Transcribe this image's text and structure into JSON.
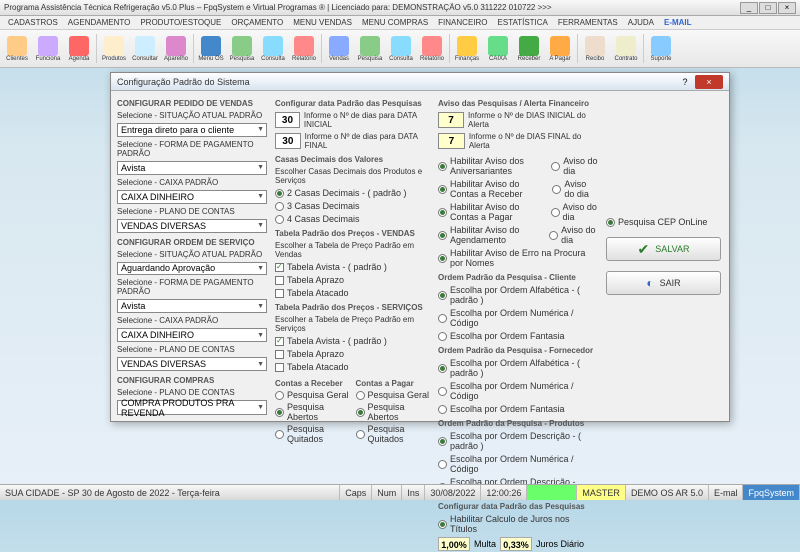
{
  "window": {
    "title": "Programa Assistência Técnica Refrigeração v5.0 Plus – FpqSystem e Virtual Programas ® | Licenciado para: DEMONSTRAÇÃO v5.0 311222 010722 >>>"
  },
  "menu": [
    "CADASTROS",
    "AGENDAMENTO",
    "PRODUTO/ESTOQUE",
    "ORÇAMENTO",
    "MENU VENDAS",
    "MENU COMPRAS",
    "FINANCEIRO",
    "ESTATÍSTICA",
    "FERRAMENTAS",
    "AJUDA",
    "E-MAIL"
  ],
  "toolbar": [
    {
      "label": "Clientes",
      "c": "#ffcc88"
    },
    {
      "label": "Funciona",
      "c": "#ccaaff"
    },
    {
      "label": "Agenda",
      "c": "#ff6666"
    },
    {
      "label": "Produtos",
      "c": "#ffeecc"
    },
    {
      "label": "Consultar",
      "c": "#cceeff"
    },
    {
      "label": "Aparelho",
      "c": "#dd88cc"
    },
    {
      "label": "Menu OS",
      "c": "#4488cc"
    },
    {
      "label": "Pesquisa",
      "c": "#88cc88"
    },
    {
      "label": "Consulta",
      "c": "#88ddff"
    },
    {
      "label": "Relatório",
      "c": "#ff8888"
    },
    {
      "label": "Vendas",
      "c": "#88aaff"
    },
    {
      "label": "Pesquisa",
      "c": "#88cc88"
    },
    {
      "label": "Consulta",
      "c": "#88ddff"
    },
    {
      "label": "Relatório",
      "c": "#ff8888"
    },
    {
      "label": "Finanças",
      "c": "#ffcc44"
    },
    {
      "label": "CAIXA",
      "c": "#66dd88"
    },
    {
      "label": "Receber",
      "c": "#44aa44"
    },
    {
      "label": "A Pagar",
      "c": "#ffaa44"
    },
    {
      "label": "Recibo",
      "c": "#eeddcc"
    },
    {
      "label": "Contrato",
      "c": "#eeeecc"
    },
    {
      "label": "Suporte",
      "c": "#88ccff"
    }
  ],
  "dialog": {
    "title": "Configuração Padrão do Sistema",
    "vendas": {
      "head": "CONFIGURAR PEDIDO DE VENDAS",
      "sit_lbl": "Selecione - SITUAÇÃO ATUAL PADRÃO",
      "sit_val": "Entrega direto para o cliente",
      "pag_lbl": "Selecione - FORMA DE PAGAMENTO PADRÃO",
      "pag_val": "Avista",
      "cx_lbl": "Selecione - CAIXA PADRÃO",
      "cx_val": "CAIXA DINHEIRO",
      "pc_lbl": "Selecione - PLANO DE CONTAS",
      "pc_val": "VENDAS DIVERSAS"
    },
    "os": {
      "head": "CONFIGURAR ORDEM DE SERVIÇO",
      "sit_lbl": "Selecione - SITUAÇÃO ATUAL PADRÃO",
      "sit_val": "Aguardando Aprovação",
      "pag_lbl": "Selecione - FORMA DE PAGAMENTO PADRÃO",
      "pag_val": "Avista",
      "cx_lbl": "Selecione - CAIXA PADRÃO",
      "cx_val": "CAIXA DINHEIRO",
      "pc_lbl": "Selecione - PLANO DE CONTAS",
      "pc_val": "VENDAS DIVERSAS"
    },
    "compras": {
      "head": "CONFIGURAR COMPRAS",
      "pc_lbl": "Selecione - PLANO DE CONTAS",
      "pc_val": "COMPRA PRODUTOS PRA REVENDA"
    },
    "datas": {
      "head": "Configurar data Padrão das Pesquisas",
      "ini_val": "30",
      "ini_lbl": "Informe o Nº de dias para DATA INICIAL",
      "fin_val": "30",
      "fin_lbl": "Informe o Nº de dias para DATA FINAL"
    },
    "decimais": {
      "head": "Casas Decimais dos Valores",
      "sub": "Escolher Casas Decimais dos Produtos e Serviços",
      "o1": "2 Casas Decimais - ( padrão )",
      "o2": "3 Casas Decimais",
      "o3": "4 Casas Decimais"
    },
    "prevendas": {
      "head": "Tabela Padrão dos Preços - VENDAS",
      "sub": "Escolher a Tabela de Preço Padrão em Vendas",
      "o1": "Tabela Avista - ( padrão )",
      "o2": "Tabela Aprazo",
      "o3": "Tabela Atacado"
    },
    "preserv": {
      "head": "Tabela Padrão dos Preços - SERVIÇOS",
      "sub": "Escolher a Tabela de Preço Padrão em Serviços",
      "o1": "Tabela Avista - ( padrão )",
      "o2": "Tabela Aprazo",
      "o3": "Tabela Atacado"
    },
    "receber": {
      "head": "Contas a Receber",
      "o1": "Pesquisa Geral",
      "o2": "Pesquisa Abertos",
      "o3": "Pesquisa Quitados"
    },
    "pagar": {
      "head": "Contas a Pagar",
      "o1": "Pesquisa Geral",
      "o2": "Pesquisa Abertos",
      "o3": "Pesquisa Quitados"
    },
    "avisos": {
      "head": "Aviso das Pesquisas / Alerta Financeiro",
      "ini_val": "7",
      "ini_lbl": "Informe o Nº de DIAS INICIAL do Alerta",
      "fin_val": "7",
      "fin_lbl": "Informe o Nº de DIAS FINAL do Alerta",
      "c1": "Habilitar Aviso dos Aniversariantes",
      "c1b": "Aviso do dia",
      "c2": "Habilitar Aviso do Contas a Receber",
      "c2b": "Aviso do dia",
      "c3": "Habilitar Aviso do Contas a Pagar",
      "c3b": "Aviso do dia",
      "c4": "Habilitar Aviso do Agendamento",
      "c4b": "Aviso do dia",
      "c5": "Habilitar Aviso de Erro na Procura por Nomes"
    },
    "ordcli": {
      "head": "Ordem Padrão da Pesquisa - Cliente",
      "o1": "Escolha por Ordem Alfabética - ( padrão )",
      "o2": "Escolha por Ordem Numérica / Código",
      "o3": "Escolha por Ordem Fantasia"
    },
    "ordfor": {
      "head": "Ordem Padrão da Pesquisa - Fornecedor",
      "o1": "Escolha por Ordem Alfabética - ( padrão )",
      "o2": "Escolha por Ordem Numérica / Código",
      "o3": "Escolha por Ordem Fantasia"
    },
    "ordprod": {
      "head": "Ordem Padrão da Pesquisa - Produtos",
      "o1": "Escolha por Ordem Descrição - ( padrão )",
      "o2": "Escolha por Ordem Numérica / Código",
      "o3": "Escolha por Ordem Descrição - Rastrear Palavra"
    },
    "juros": {
      "head": "Configurar data Padrão das Pesquisas",
      "chk": "Habilitar Calculo de Juros nos Títulos",
      "v1": "1,00%",
      "l1": "Multa",
      "v2": "0,33%",
      "l2": "Juros Diário"
    },
    "cep": "Pesquisa CEP OnLine",
    "save": "SALVAR",
    "exit": "SAIR"
  },
  "status": {
    "city": "SUA CIDADE - SP 30 de Agosto de 2022 - Terça-feira",
    "caps": "Caps",
    "num": "Num",
    "ins": "Ins",
    "date": "30/08/2022",
    "time": "12:00:26",
    "user": "MASTER",
    "demo": "DEMO OS AR 5.0",
    "mail": "E-mal",
    "brand": "FpqSystem"
  }
}
